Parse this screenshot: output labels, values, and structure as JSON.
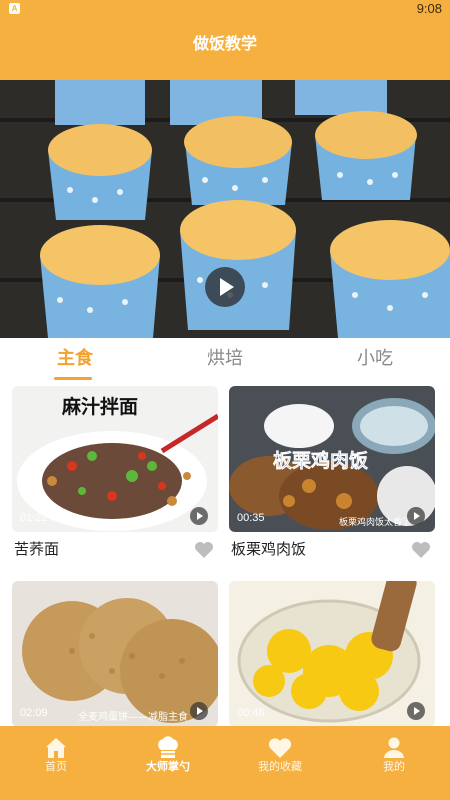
{
  "status_bar": {
    "indicator": "A",
    "time": "9:08"
  },
  "header": {
    "title": "做饭教学"
  },
  "banner": {
    "play_icon": "play-icon"
  },
  "tabs": [
    {
      "label": "主食",
      "active": true
    },
    {
      "label": "烘培",
      "active": false
    },
    {
      "label": "小吃",
      "active": false
    }
  ],
  "videos": [
    {
      "title": "苦荞面",
      "duration": "01:22",
      "thumb_text": "麻汁拌面",
      "overlay_caption": ""
    },
    {
      "title": "板栗鸡肉饭",
      "duration": "00:35",
      "thumb_text": "板栗鸡肉饭",
      "overlay_caption": "板栗鸡肉饭太香了"
    },
    {
      "title": "",
      "duration": "02:09",
      "thumb_text": "",
      "overlay_caption": "全麦鸡蛋饼——减脂主食"
    },
    {
      "title": "",
      "duration": "00:48",
      "thumb_text": "",
      "overlay_caption": ""
    }
  ],
  "bottom_nav": [
    {
      "label": "首页",
      "icon": "home-icon",
      "active": false
    },
    {
      "label": "大师掌勺",
      "icon": "chef-hat-icon",
      "active": true
    },
    {
      "label": "我的收藏",
      "icon": "heart-icon",
      "active": false
    },
    {
      "label": "我的",
      "icon": "user-icon",
      "active": false
    }
  ],
  "colors": {
    "accent": "#f6b040",
    "tab_active": "#f2a22e"
  }
}
